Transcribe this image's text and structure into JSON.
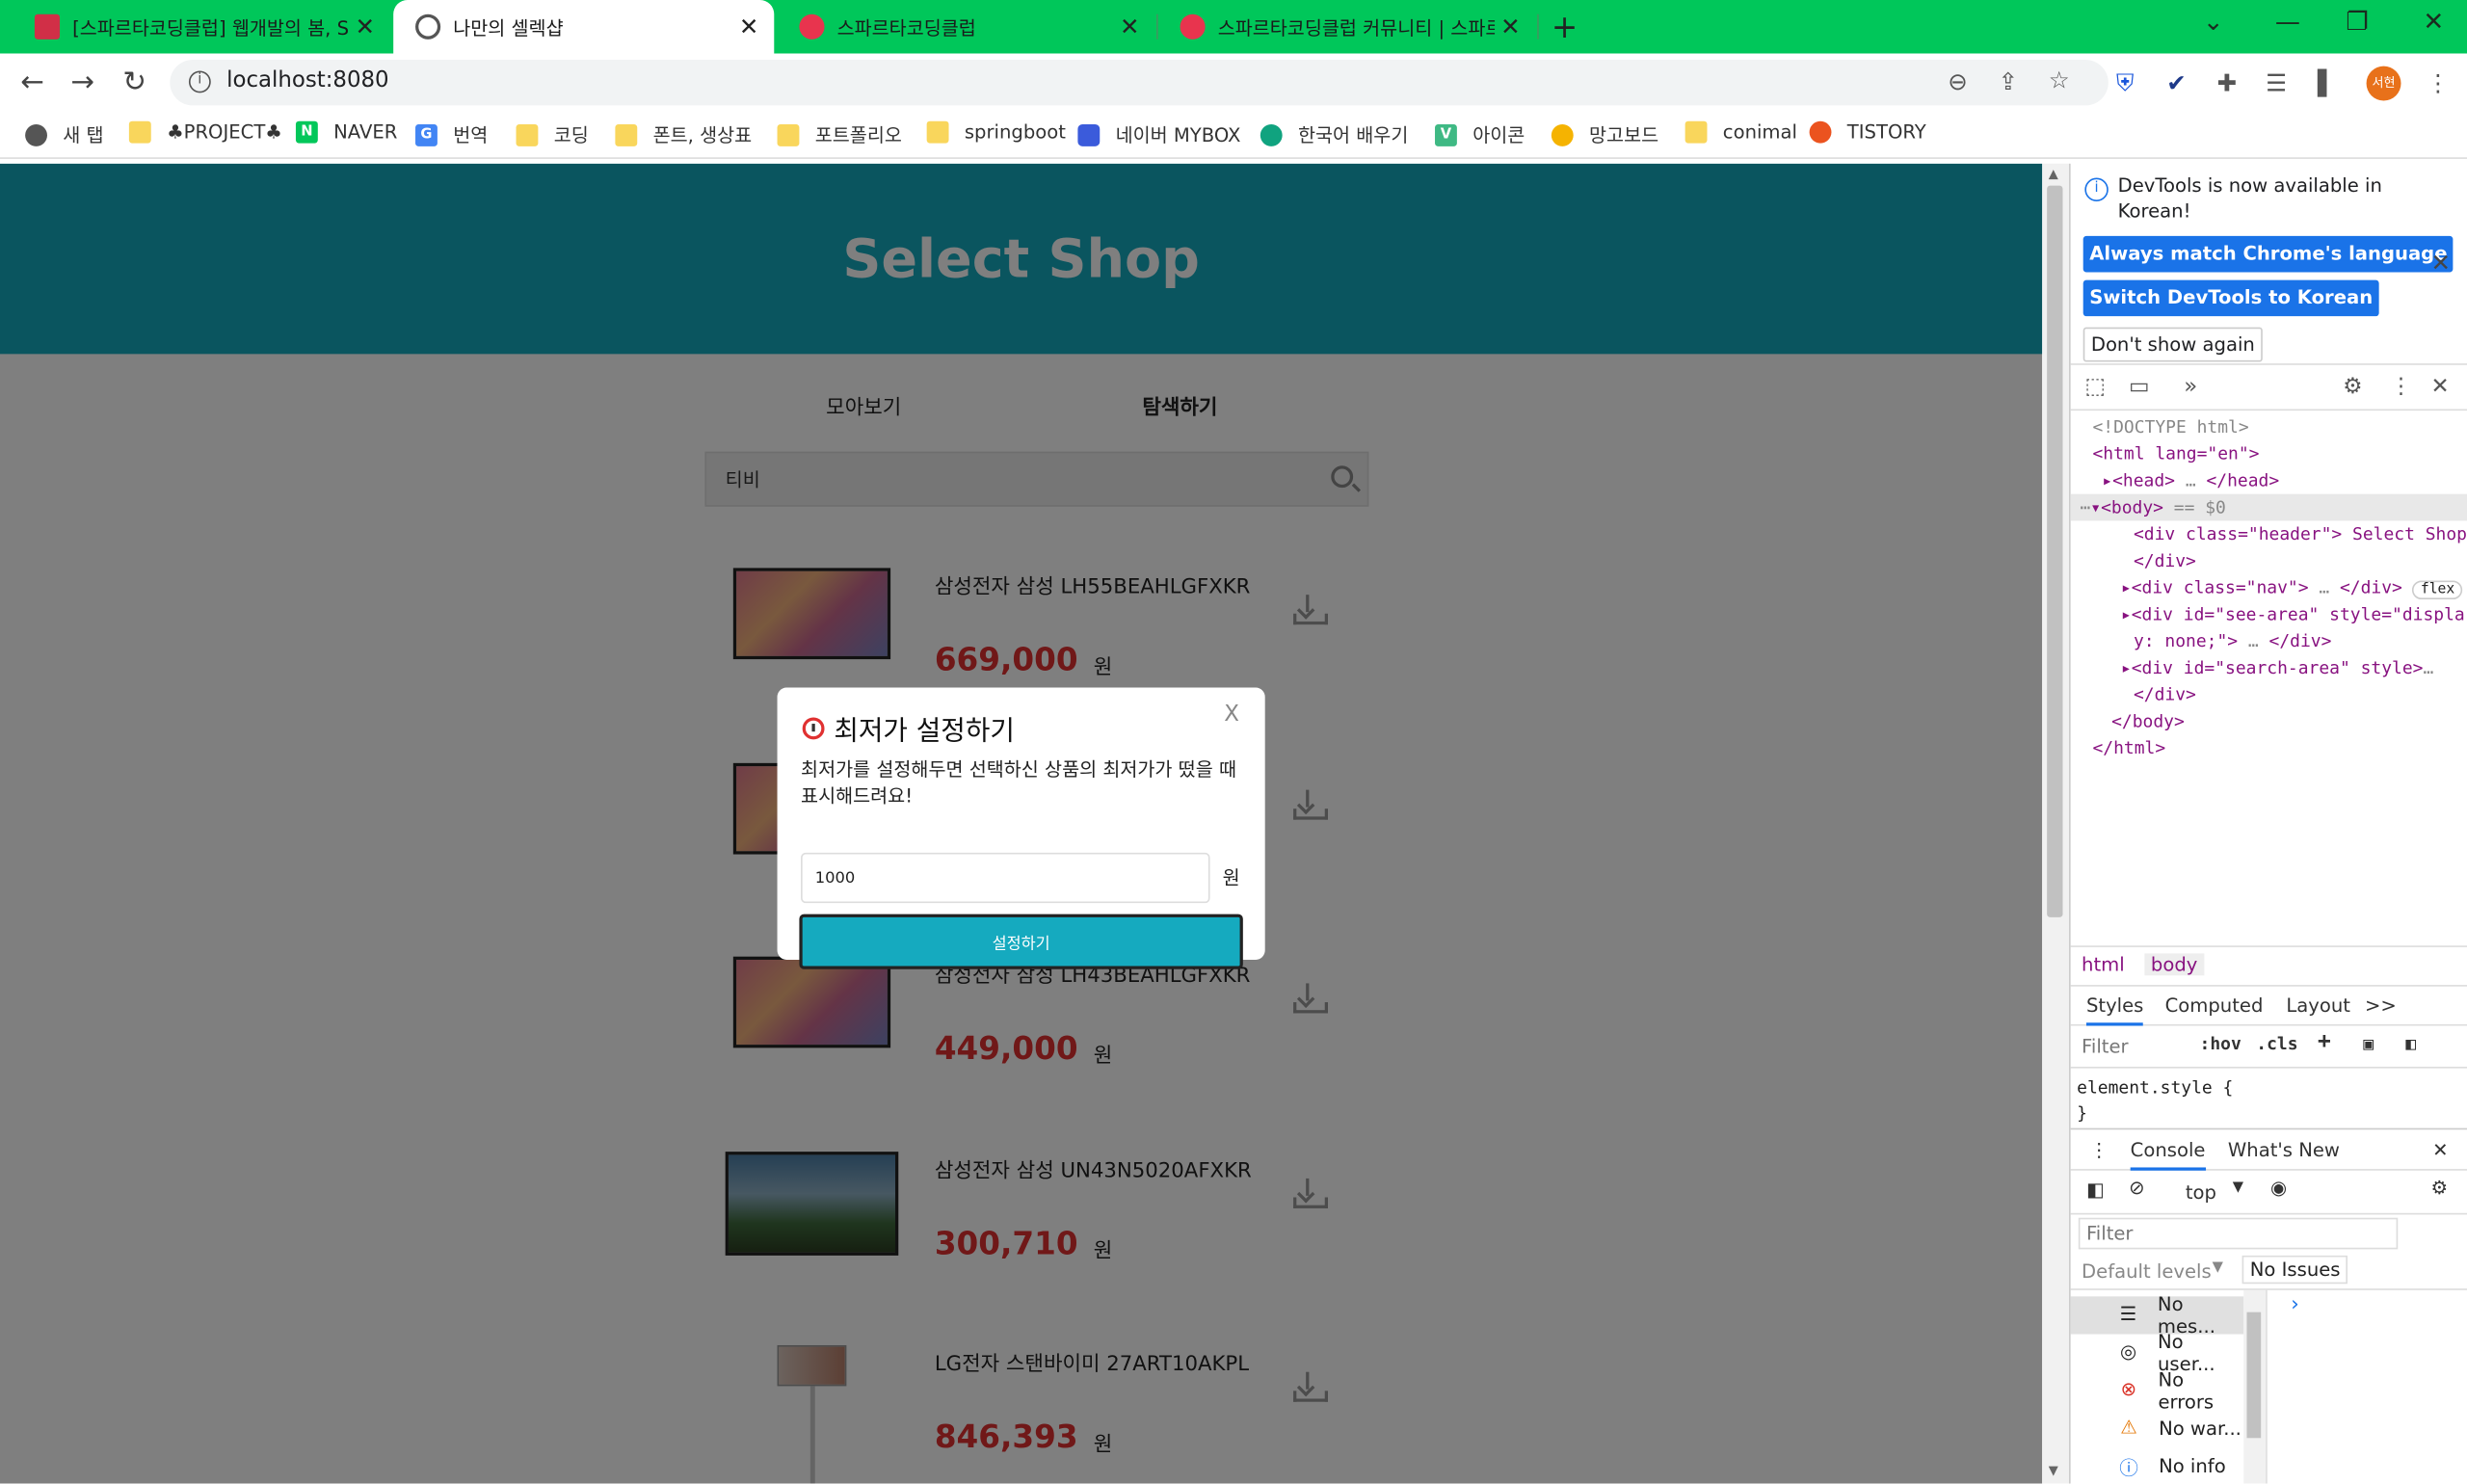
{
  "browser": {
    "tabs": [
      {
        "title": "[스파르타코딩클럽] 웹개발의 봄, Sp",
        "active": false
      },
      {
        "title": "나만의 셀렉샵",
        "active": true
      },
      {
        "title": "스파르타코딩클럽",
        "active": false
      },
      {
        "title": "스파르타코딩클럽 커뮤니티 | 스파르",
        "active": false
      }
    ],
    "url": "localhost:8080",
    "profile_initials": "서현",
    "bookmarks": [
      "새 탭",
      "♣PROJECT♣",
      "NAVER",
      "번역",
      "코딩",
      "폰트, 생상표",
      "포트폴리오",
      "springboot",
      "네이버 MYBOX",
      "한국어 배우기",
      "아이콘",
      "망고보드",
      "conimal",
      "TISTORY"
    ]
  },
  "page": {
    "header_title": "Select Shop",
    "nav": {
      "see": "모아보기",
      "search": "탐색하기"
    },
    "search_value": "티비",
    "currency": "원",
    "products": [
      {
        "name": "삼성전자 삼성 LH55BEAHLGFXKR",
        "price": "669,000",
        "image": "tv-abstract"
      },
      {
        "name": "",
        "price": "",
        "image": "tv-abstract"
      },
      {
        "name": "삼성전자 삼성 LH43BEAHLGFXKR",
        "price": "449,000",
        "image": "tv-abstract"
      },
      {
        "name": "삼성전자 삼성 UN43N5020AFXKR",
        "price": "300,710",
        "image": "tv-landscape"
      },
      {
        "name": "LG전자 스탠바이미 27ART10AKPL",
        "price": "846,393",
        "image": "tv-stand"
      }
    ],
    "modal": {
      "title": "최저가 설정하기",
      "close": "X",
      "description_line1": "최저가를 설정해두면 선택하신 상품의 최저가가 떴을 때",
      "description_line2": "표시해드려요!",
      "input_value": "1000",
      "unit": "원",
      "submit": "설정하기"
    }
  },
  "devtools": {
    "notice": "DevTools is now available in Korean!",
    "btn_match": "Always match Chrome's language",
    "btn_switch": "Switch DevTools to Korean",
    "btn_dont": "Don't show again",
    "dom": {
      "doctype": "<!DOCTYPE html>",
      "html_open": "<html lang=\"en\">",
      "head": "<head>",
      "head_close": "</head>",
      "body_open": "<body>",
      "body_marker": "== $0",
      "div_header": "<div class=\"header\"> Select Shop",
      "div_close": "</div>",
      "div_nav": "<div class=\"nav\">",
      "div_nav_close": "</div>",
      "flex": "flex",
      "div_see_1": "<div id=\"see-area\" style=\"displa",
      "div_see_2": "y: none;\">",
      "div_see_close": "</div>",
      "div_search": "<div id=\"search-area\" style>",
      "div_search_close": "</div>",
      "body_close": "</body>",
      "html_close": "</html>"
    },
    "crumbs": [
      "html",
      "body"
    ],
    "style_tabs": [
      "Styles",
      "Computed",
      "Layout",
      ">>"
    ],
    "filter_placeholder": "Filter",
    "hov": ":hov",
    "cls": ".cls",
    "element_style": "element.style {",
    "element_style_close": "}",
    "console_tabs": [
      "Console",
      "What's New"
    ],
    "context": "top",
    "console_filter": "Filter",
    "default_levels": "Default levels",
    "no_issues": "No Issues",
    "console_items": [
      "No mes...",
      "No user...",
      "No errors",
      "No war...",
      "No info"
    ]
  }
}
